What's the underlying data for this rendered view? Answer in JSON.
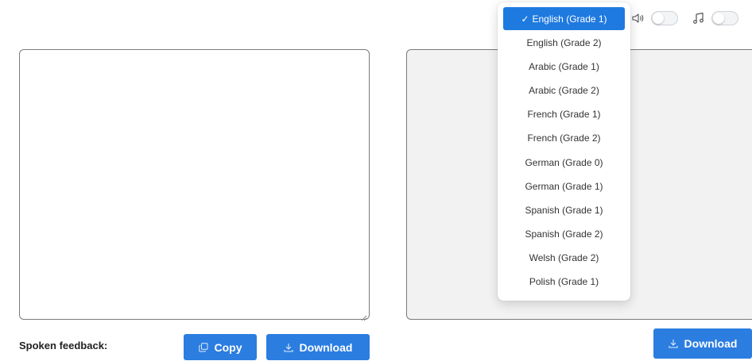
{
  "language_menu": {
    "selected_index": 0,
    "check_mark": "✓",
    "items": [
      {
        "label": "English (Grade 1)"
      },
      {
        "label": "English (Grade 2)"
      },
      {
        "label": "Arabic (Grade 1)"
      },
      {
        "label": "Arabic (Grade 2)"
      },
      {
        "label": "French (Grade 1)"
      },
      {
        "label": "French (Grade 2)"
      },
      {
        "label": "German (Grade 0)"
      },
      {
        "label": "German (Grade 1)"
      },
      {
        "label": "Spanish (Grade 1)"
      },
      {
        "label": "Spanish (Grade 2)"
      },
      {
        "label": "Welsh (Grade 2)"
      },
      {
        "label": "Polish (Grade 1)"
      }
    ]
  },
  "top_controls": {
    "sound_icon": "speaker-icon",
    "sound_toggle_on": false,
    "music_icon": "music-note-icon",
    "music_toggle_on": false
  },
  "input": {
    "value": ""
  },
  "output": {
    "value": ""
  },
  "footer": {
    "spoken_feedback_label": "Spoken feedback:",
    "copy_label": "Copy",
    "download_label": "Download",
    "output_download_label": "Download"
  },
  "colors": {
    "accent": "#2b7de0",
    "selected_item": "#1f7ae0",
    "output_bg": "#f2f2f2"
  }
}
